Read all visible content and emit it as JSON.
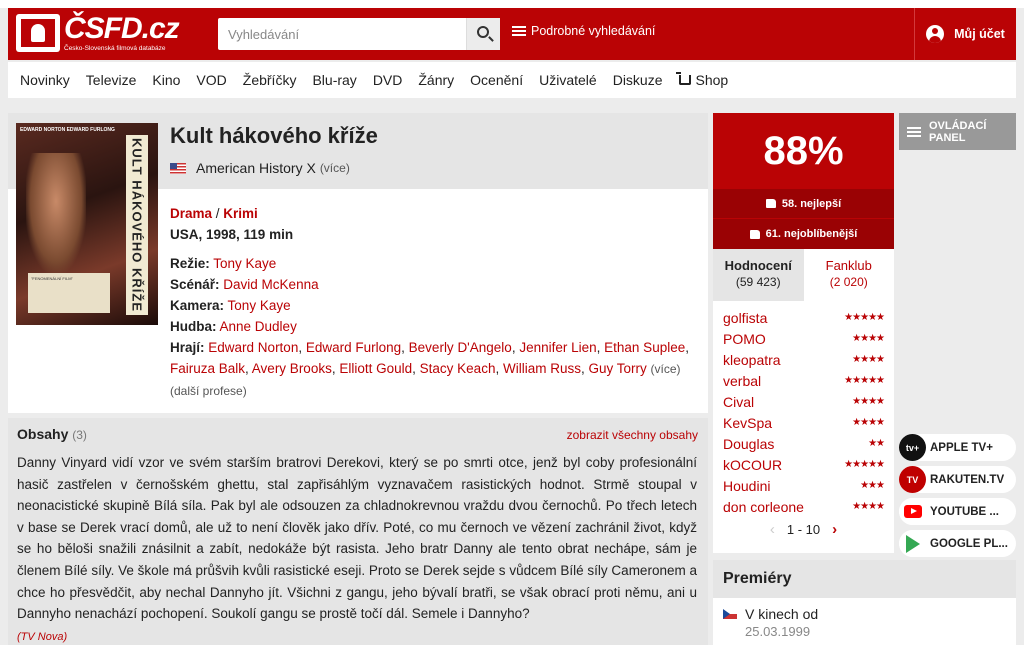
{
  "header": {
    "logo_text": "ČSFD.cz",
    "logo_sub": "Česko-Slovenská filmová databáze",
    "search_placeholder": "Vyhledávání",
    "advanced_search": "Podrobné vyhledávání",
    "account": "Můj účet"
  },
  "nav": [
    "Novinky",
    "Televize",
    "Kino",
    "VOD",
    "Žebříčky",
    "Blu-ray",
    "DVD",
    "Žánry",
    "Ocenění",
    "Uživatelé",
    "Diskuze",
    "Shop"
  ],
  "film": {
    "title": "Kult hákového kříže",
    "original_title": "American History X",
    "more": "(více)",
    "genres": [
      "Drama",
      "Krimi"
    ],
    "genre_sep": " / ",
    "origin": "USA, 1998, 119 min",
    "poster_names": "EDWARD NORTON     EDWARD FURLONG",
    "poster_title": "KULT HÁKOVÉHO KŘÍŽE",
    "poster_tag": "\"FENOMENÁLNÍ FILM\"",
    "credits": {
      "rezie_label": "Režie:",
      "rezie": "Tony Kaye",
      "scenar_label": "Scénář:",
      "scenar": "David McKenna",
      "kamera_label": "Kamera:",
      "kamera": "Tony Kaye",
      "hudba_label": "Hudba:",
      "hudba": "Anne Dudley",
      "hraji_label": "Hrají:",
      "hraji": [
        "Edward Norton",
        "Edward Furlong",
        "Beverly D'Angelo",
        "Jennifer Lien",
        "Ethan Suplee",
        "Fairuza Balk",
        "Avery Brooks",
        "Elliott Gould",
        "Stacy Keach",
        "William Russ",
        "Guy Torry"
      ],
      "more": "(více)",
      "more_profese": "(další profese)"
    }
  },
  "plot": {
    "heading": "Obsahy",
    "count": "(3)",
    "show_all": "zobrazit všechny obsahy",
    "text": "Danny Vinyard vidí vzor ve svém starším bratrovi Derekovi, který se po smrti otce, jenž byl coby profesionální hasič zastřelen v černošském ghettu, stal zapřisáhlým vyznavačem rasistických hodnot. Strmě stoupal v neonacistické skupině Bílá síla. Pak byl ale odsouzen za chladnokrevnou vraždu dvou černochů. Po třech letech v base se Derek vrací domů, ale už to není člověk jako dřív. Poté, co mu černoch ve vězení zachránil život, když se ho běloši snažili znásilnit a zabít, nedokáže být rasista. Jeho bratr Danny ale tento obrat nechápe, sám je členem Bílé síly. Ve škole má průšvih kvůli rasistické eseji. Proto se Derek sejde s vůdcem Bílé síly Cameronem a chce ho přesvědčit, aby nechal Dannyho jít. Všichni z gangu, jeho bývalí bratři, se však obrací proti němu, ani u Dannyho nenachází pochopení. Soukolí gangu se prostě točí dál. Semele i Dannyho?",
    "source": "(TV Nova)"
  },
  "rating": {
    "percent": "88%",
    "rank_best": "58. nejlepší",
    "rank_popular": "61. nejoblíbenější",
    "tab_ratings": "Hodnocení",
    "tab_ratings_count": "(59 423)",
    "tab_fanclub": "Fanklub",
    "tab_fanclub_count": "(2 020)",
    "users": [
      {
        "name": "golfista",
        "stars": 5
      },
      {
        "name": "POMO",
        "stars": 4
      },
      {
        "name": "kleopatra",
        "stars": 4
      },
      {
        "name": "verbal",
        "stars": 5
      },
      {
        "name": "Cival",
        "stars": 4
      },
      {
        "name": "KevSpa",
        "stars": 4
      },
      {
        "name": "Douglas",
        "stars": 2
      },
      {
        "name": "kOCOUR",
        "stars": 5
      },
      {
        "name": "Houdini",
        "stars": 3
      },
      {
        "name": "don corleone",
        "stars": 4
      }
    ],
    "pager": "1 - 10"
  },
  "premiery": {
    "heading": "Premiéry",
    "row_label": "V kinech od",
    "row_date": "25.03.1999"
  },
  "panel": {
    "label": "OVLÁDACÍ PANEL"
  },
  "vod": [
    {
      "name": "APPLE TV+",
      "icon": "apple-tv-icon",
      "badge": "tv+"
    },
    {
      "name": "RAKUTEN.TV",
      "icon": "rakuten-icon",
      "badge": "TV"
    },
    {
      "name": "YOUTUBE ...",
      "icon": "youtube-icon",
      "badge": ""
    },
    {
      "name": "GOOGLE PL...",
      "icon": "google-play-icon",
      "badge": ""
    }
  ],
  "colors": {
    "brand": "#ba0305",
    "rank_bg": "#9a0204",
    "panel_bg": "#e5e5e5"
  }
}
